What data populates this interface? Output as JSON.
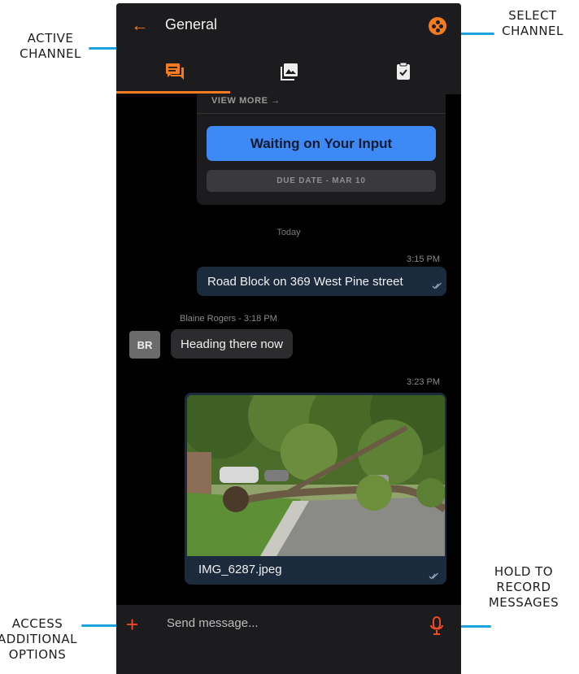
{
  "callouts": {
    "active_channel": [
      "ACTIVE",
      "CHANNEL"
    ],
    "select_channel": [
      "SELECT",
      "CHANNEL"
    ],
    "hold_record": [
      "HOLD TO",
      "RECORD",
      "MESSAGES"
    ],
    "access_options": [
      "ACCESS",
      "ADDITIONAL",
      "OPTIONS"
    ]
  },
  "header": {
    "title": "General",
    "back_icon": "arrow-left-icon",
    "channel_icon": "channel-select-icon"
  },
  "tabs": [
    {
      "icon": "chat-bubbles-icon",
      "active": true
    },
    {
      "icon": "photo-gallery-icon",
      "active": false
    },
    {
      "icon": "task-checklist-icon",
      "active": false
    }
  ],
  "task_card": {
    "view_more": "VIEW MORE →",
    "status": "Waiting on Your Input",
    "due": "DUE DATE - MAR 10"
  },
  "messages": {
    "day_label": "Today",
    "msg1": {
      "time": "3:15 PM",
      "text": "Road Block on 369 West Pine street"
    },
    "msg2": {
      "sender": "Blaine Rogers - 3:18 PM",
      "initials": "BR",
      "text": "Heading there now"
    },
    "msg3": {
      "time": "3:23 PM",
      "filename": "IMG_6287.jpeg"
    }
  },
  "composer": {
    "placeholder": "Send message...",
    "plus_icon": "plus-icon",
    "mic_icon": "microphone-icon"
  },
  "colors": {
    "accent": "#f47b20",
    "callout_line": "#1aa3dc",
    "status_blue": "#3d8af7",
    "background": "#000000"
  }
}
